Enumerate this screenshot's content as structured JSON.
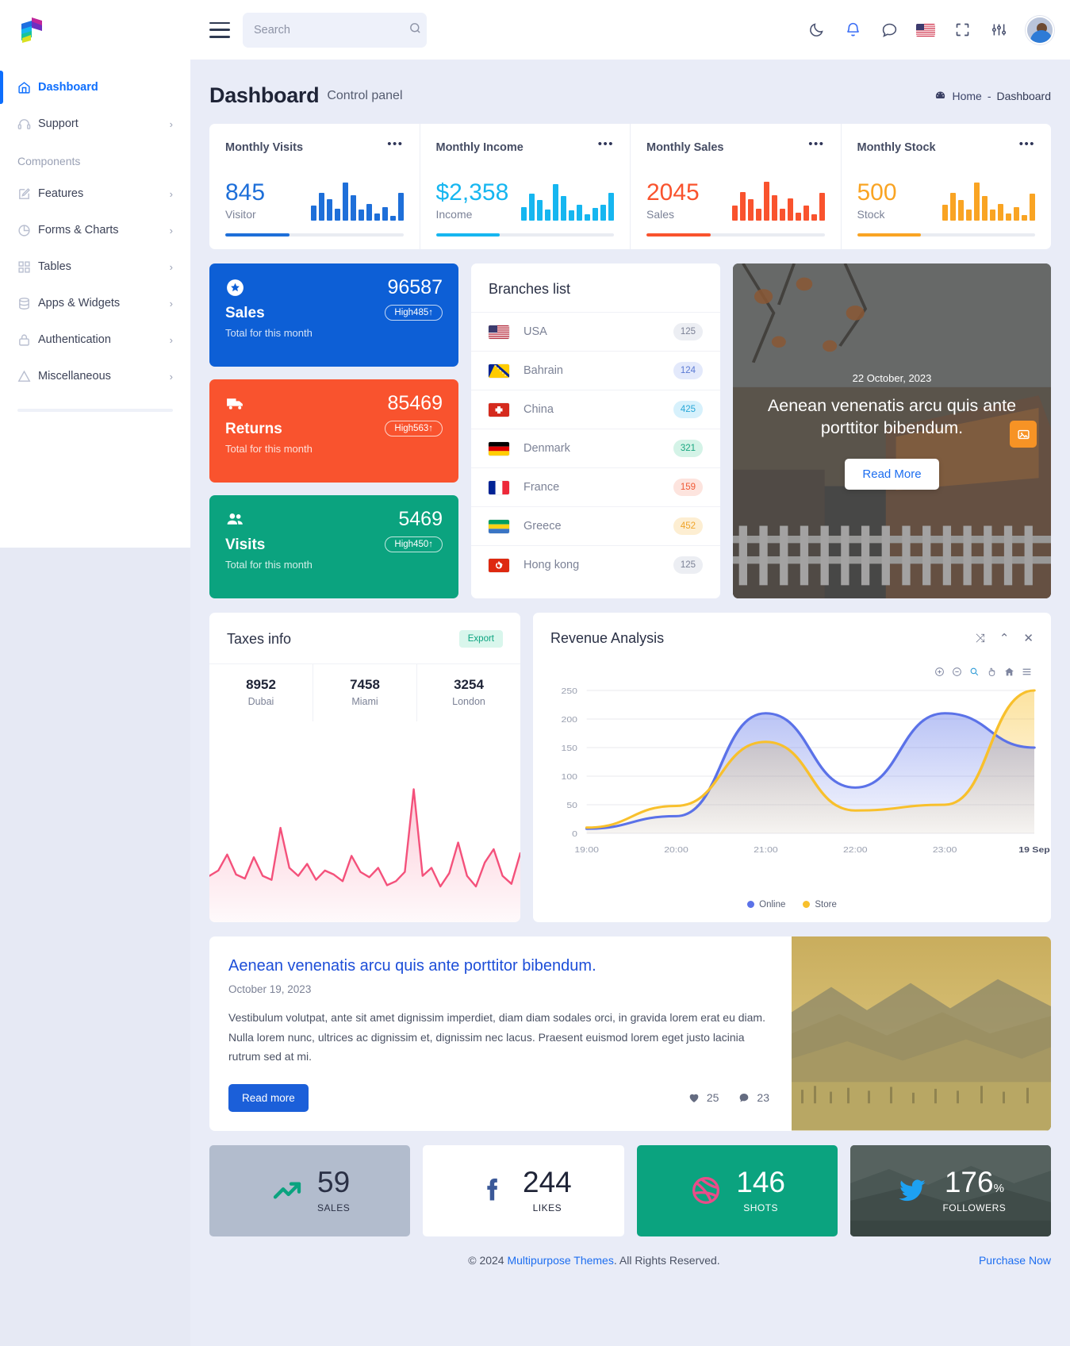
{
  "brand": {
    "logo_icon": "multipurpose-themes-logo"
  },
  "sidebar": {
    "items": [
      {
        "label": "Dashboard",
        "icon": "home-icon",
        "active": true,
        "chevron": ""
      },
      {
        "label": "Support",
        "icon": "headset-icon",
        "active": false,
        "chevron": "›"
      }
    ],
    "section_label": "Components",
    "components": [
      {
        "label": "Features",
        "icon": "edit-square-icon",
        "chevron": "›"
      },
      {
        "label": "Forms & Charts",
        "icon": "pie-chart-icon",
        "chevron": "›"
      },
      {
        "label": "Tables",
        "icon": "grid-icon",
        "chevron": "›"
      },
      {
        "label": "Apps & Widgets",
        "icon": "database-icon",
        "chevron": "›"
      },
      {
        "label": "Authentication",
        "icon": "lock-icon",
        "chevron": "›"
      },
      {
        "label": "Miscellaneous",
        "icon": "warning-triangle-icon",
        "chevron": "›"
      }
    ]
  },
  "topbar": {
    "menu_icon": "hamburger-icon",
    "search": {
      "placeholder": "Search",
      "value": "",
      "icon": "search-icon"
    },
    "icons": [
      {
        "name": "moon-icon",
        "accent": false
      },
      {
        "name": "bell-icon",
        "accent": true
      },
      {
        "name": "chat-icon",
        "accent": false
      },
      {
        "name": "flag-us-icon",
        "accent": false
      },
      {
        "name": "fullscreen-icon",
        "accent": false
      },
      {
        "name": "settings-sliders-icon",
        "accent": false
      }
    ],
    "avatar": "user-avatar"
  },
  "page": {
    "title": "Dashboard",
    "subtitle": "Control panel",
    "breadcrumb": {
      "icon": "dashboard-icon",
      "home": "Home",
      "separator": "-",
      "current": "Dashboard"
    }
  },
  "monthly": [
    {
      "title": "Monthly Visits",
      "value": "845",
      "label": "Visitor",
      "color": "#1e6fd9",
      "progress": 36,
      "bars": [
        32,
        60,
        46,
        26,
        82,
        55,
        24,
        36,
        16,
        30,
        10,
        60
      ]
    },
    {
      "title": "Monthly Income",
      "value": "$2,358",
      "label": "Income",
      "color": "#16b6f0",
      "progress": 36,
      "bars": [
        30,
        58,
        44,
        24,
        80,
        54,
        22,
        34,
        14,
        28,
        34,
        60
      ]
    },
    {
      "title": "Monthly Sales",
      "value": "2045",
      "label": "Sales",
      "color": "#f9532e",
      "progress": 36,
      "bars": [
        32,
        62,
        46,
        26,
        84,
        56,
        26,
        48,
        18,
        32,
        14,
        60
      ]
    },
    {
      "title": "Monthly Stock",
      "value": "500",
      "label": "Stock",
      "color": "#f9a423",
      "progress": 36,
      "bars": [
        34,
        60,
        44,
        24,
        82,
        54,
        24,
        36,
        16,
        30,
        12,
        58
      ]
    }
  ],
  "stats": [
    {
      "name": "Sales",
      "value": "96587",
      "badge": "High485↑",
      "sub": "Total for this month",
      "theme": "blue",
      "icon": "star-badge-icon"
    },
    {
      "name": "Returns",
      "value": "85469",
      "badge": "High563↑",
      "sub": "Total for this month",
      "theme": "orange",
      "icon": "truck-icon"
    },
    {
      "name": "Visits",
      "value": "5469",
      "badge": "High450↑",
      "sub": "Total for this month",
      "theme": "green",
      "icon": "users-icon"
    }
  ],
  "branches": {
    "title": "Branches list",
    "rows": [
      {
        "country": "USA",
        "count": "125",
        "flag": "usa-flag-icon",
        "badge_bg": "#eceef3",
        "badge_fg": "#7c8296"
      },
      {
        "country": "Bahrain",
        "count": "124",
        "flag": "bosnia-flag-icon",
        "badge_bg": "#e3e9fb",
        "badge_fg": "#5b7ad4"
      },
      {
        "country": "China",
        "count": "425",
        "flag": "switzerland-flag-icon",
        "badge_bg": "#d7f1fc",
        "badge_fg": "#2aa8d8"
      },
      {
        "country": "Denmark",
        "count": "321",
        "flag": "germany-flag-icon",
        "badge_bg": "#d4f3e7",
        "badge_fg": "#18a67f"
      },
      {
        "country": "France",
        "count": "159",
        "flag": "france-flag-icon",
        "badge_bg": "#fde4de",
        "badge_fg": "#f05a36"
      },
      {
        "country": "Greece",
        "count": "452",
        "flag": "gabon-flag-icon",
        "badge_bg": "#fdeed2",
        "badge_fg": "#f0a42a"
      },
      {
        "country": "Hong kong",
        "count": "125",
        "flag": "hongkong-flag-icon",
        "badge_bg": "#eceef3",
        "badge_fg": "#7c8296"
      }
    ]
  },
  "promo": {
    "date": "22 October, 2023",
    "title": "Aenean venenatis arcu quis ante porttitor bibendum.",
    "button": "Read More",
    "fab_icon": "image-icon"
  },
  "taxes": {
    "title": "Taxes info",
    "export_label": "Export",
    "stats": [
      {
        "value": "8952",
        "city": "Dubai"
      },
      {
        "value": "7458",
        "city": "Miami"
      },
      {
        "value": "3254",
        "city": "London"
      }
    ]
  },
  "revenue": {
    "title": "Revenue Analysis",
    "tools": [
      {
        "name": "shuffle-icon",
        "glyph": "⤨"
      },
      {
        "name": "collapse-chevron-icon",
        "glyph": "⌃"
      },
      {
        "name": "close-icon",
        "glyph": "✕"
      }
    ],
    "chart_toolbar": [
      "zoom-in-icon",
      "zoom-out-icon",
      "selection-zoom-icon",
      "pan-icon",
      "reset-home-icon",
      "menu-icon"
    ]
  },
  "chart_data": [
    {
      "type": "area",
      "title": "Revenue Analysis",
      "xlabel": "",
      "ylabel": "",
      "ylim": [
        0,
        250
      ],
      "yticks": [
        0,
        50,
        100,
        150,
        200,
        250
      ],
      "x": [
        "19:00",
        "20:00",
        "21:00",
        "22:00",
        "23:00",
        "19 Sep"
      ],
      "grid": true,
      "legend_position": "bottom",
      "series": [
        {
          "name": "Online",
          "color": "#5b72e8",
          "values": [
            8,
            30,
            210,
            80,
            210,
            150
          ]
        },
        {
          "name": "Store",
          "color": "#f8c02c",
          "values": [
            10,
            48,
            160,
            40,
            50,
            250
          ]
        }
      ]
    },
    {
      "type": "line",
      "title": "Taxes info",
      "color": "#f4517b",
      "ylim": [
        0,
        100
      ],
      "values": [
        30,
        34,
        46,
        31,
        28,
        44,
        30,
        27,
        66,
        36,
        30,
        39,
        27,
        34,
        31,
        26,
        45,
        33,
        29,
        36,
        23,
        26,
        33,
        95,
        30,
        36,
        22,
        32,
        55,
        30,
        22,
        40,
        50,
        30,
        24,
        47
      ]
    }
  ],
  "blog": {
    "title": "Aenean venenatis arcu quis ante porttitor bibendum.",
    "date": "October 19, 2023",
    "body": "Vestibulum volutpat, ante sit amet dignissim imperdiet, diam diam sodales orci, in gravida lorem erat eu diam. Nulla lorem nunc, ultrices ac dignissim et, dignissim nec lacus. Praesent euismod lorem eget justo lacinia rutrum sed at mi.",
    "button": "Read more",
    "likes": "25",
    "comments": "23",
    "like_icon": "heart-icon",
    "comment_icon": "comment-icon"
  },
  "social": [
    {
      "value": "59",
      "label": "SALES",
      "icon": "trending-up-icon",
      "theme": "gray",
      "bg": "#b2bccd",
      "fg": "#2a3045",
      "icon_color": "#0ba37f"
    },
    {
      "value": "244",
      "label": "LIKES",
      "icon": "facebook-icon",
      "theme": "white",
      "bg": "#ffffff",
      "fg": "#1f2437",
      "icon_color": "#3b5998"
    },
    {
      "value": "146",
      "label": "SHOTS",
      "icon": "dribbble-icon",
      "theme": "teal",
      "bg": "#0ba37f",
      "fg": "#ffffff",
      "icon_color": "#ea4c89"
    },
    {
      "value": "176",
      "suffix": "%",
      "label": "FOLLOWERS",
      "icon": "twitter-icon",
      "theme": "image",
      "bg": "#6e7d79",
      "fg": "#ffffff",
      "icon_color": "#1da1f2"
    }
  ],
  "footer": {
    "copyright_pre": "© 2024 ",
    "brand": "Multipurpose Themes",
    "copyright_post": ". All Rights Reserved.",
    "purchase": "Purchase Now"
  }
}
